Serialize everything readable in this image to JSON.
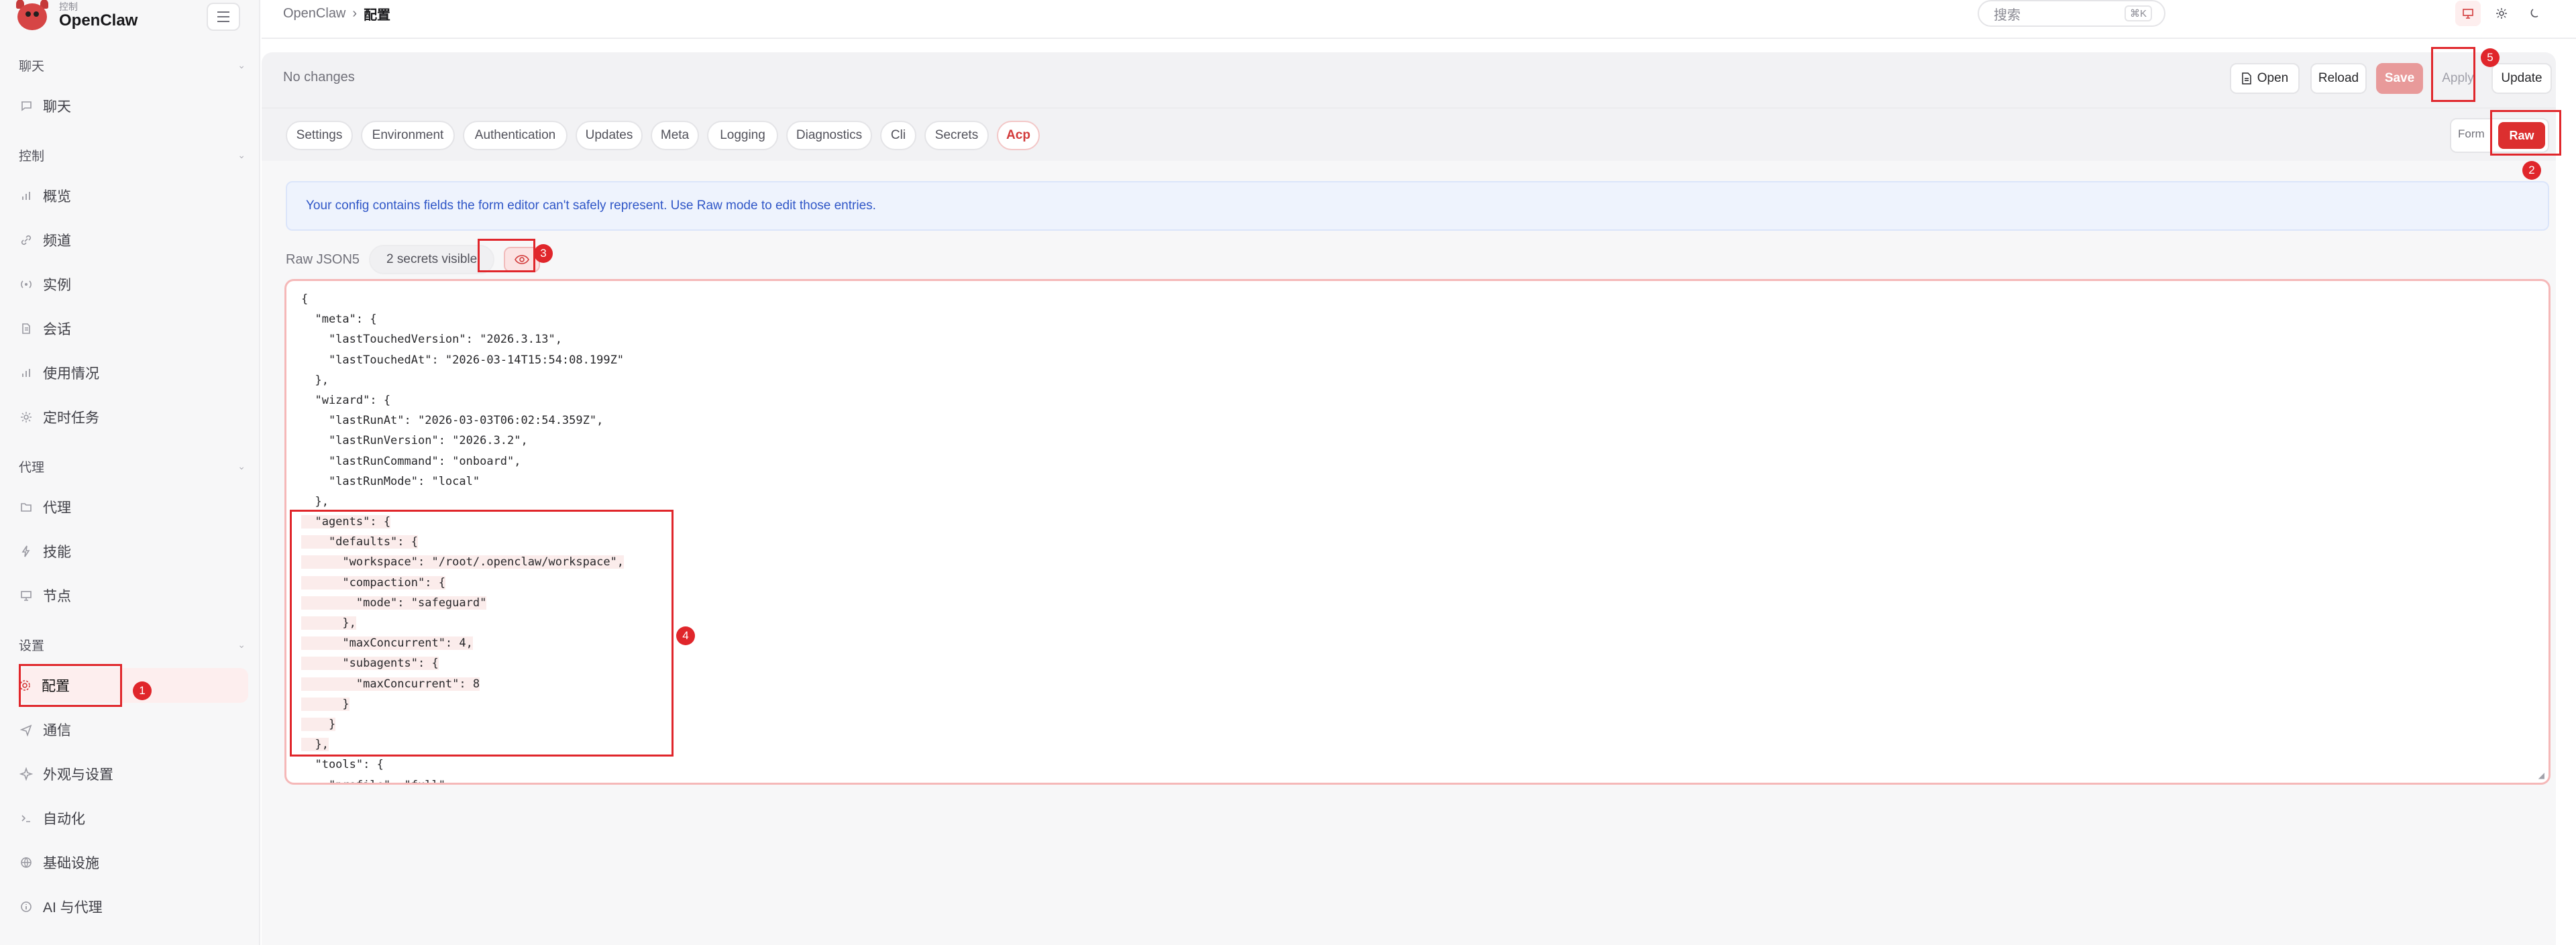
{
  "brand": {
    "sub": "控制",
    "name": "OpenClaw"
  },
  "sidebar": {
    "sections": [
      {
        "label": "聊天"
      },
      {
        "label": "控制"
      },
      {
        "label": "代理"
      },
      {
        "label": "设置"
      }
    ],
    "items": [
      {
        "label": "聊天",
        "icon": "chat-icon"
      },
      {
        "label": "概览",
        "icon": "bar-chart-icon"
      },
      {
        "label": "频道",
        "icon": "link-icon"
      },
      {
        "label": "实例",
        "icon": "broadcast-icon"
      },
      {
        "label": "会话",
        "icon": "document-icon"
      },
      {
        "label": "使用情况",
        "icon": "bar-chart-icon"
      },
      {
        "label": "定时任务",
        "icon": "sun-icon"
      },
      {
        "label": "代理",
        "icon": "folder-icon"
      },
      {
        "label": "技能",
        "icon": "lightning-icon"
      },
      {
        "label": "节点",
        "icon": "monitor-icon"
      },
      {
        "label": "配置",
        "icon": "gear-icon"
      },
      {
        "label": "通信",
        "icon": "send-icon"
      },
      {
        "label": "外观与设置",
        "icon": "sparkle-icon"
      },
      {
        "label": "自动化",
        "icon": "terminal-icon"
      },
      {
        "label": "基础设施",
        "icon": "globe-icon"
      },
      {
        "label": "AI 与代理",
        "icon": "info-icon"
      }
    ]
  },
  "breadcrumb": {
    "root": "OpenClaw",
    "sep": "›",
    "current": "配置"
  },
  "search": {
    "placeholder": "搜索",
    "shortcut": "⌘K"
  },
  "actions": {
    "status": "No changes",
    "open": "Open",
    "reload": "Reload",
    "save": "Save",
    "apply": "Apply",
    "update": "Update"
  },
  "tabs": [
    "Settings",
    "Environment",
    "Authentication",
    "Updates",
    "Meta",
    "Logging",
    "Diagnostics",
    "Cli",
    "Secrets",
    "Acp"
  ],
  "mode": {
    "form": "Form",
    "raw": "Raw"
  },
  "info": "Your config contains fields the form editor can't safely represent. Use Raw mode to edit those entries.",
  "raw": {
    "label": "Raw JSON5",
    "secrets": "2 secrets visible"
  },
  "code_lines": [
    "{",
    "  \"meta\": {",
    "    \"lastTouchedVersion\": \"2026.3.13\",",
    "    \"lastTouchedAt\": \"2026-03-14T15:54:08.199Z\"",
    "  },",
    "  \"wizard\": {",
    "    \"lastRunAt\": \"2026-03-03T06:02:54.359Z\",",
    "    \"lastRunVersion\": \"2026.3.2\",",
    "    \"lastRunCommand\": \"onboard\",",
    "    \"lastRunMode\": \"local\"",
    "  },",
    "  \"agents\": {",
    "    \"defaults\": {",
    "      \"workspace\": \"/root/.openclaw/workspace\",",
    "      \"compaction\": {",
    "        \"mode\": \"safeguard\"",
    "      },",
    "      \"maxConcurrent\": 4,",
    "      \"subagents\": {",
    "        \"maxConcurrent\": 8",
    "      }",
    "    }",
    "  },",
    "  \"tools\": {",
    "    \"profile\": \"full\""
  ],
  "annotations": [
    "1",
    "2",
    "3",
    "4",
    "5"
  ],
  "colors": {
    "accent": "#dc2f2f",
    "annotation": "#e0262b",
    "info_text": "#2f56c7"
  }
}
